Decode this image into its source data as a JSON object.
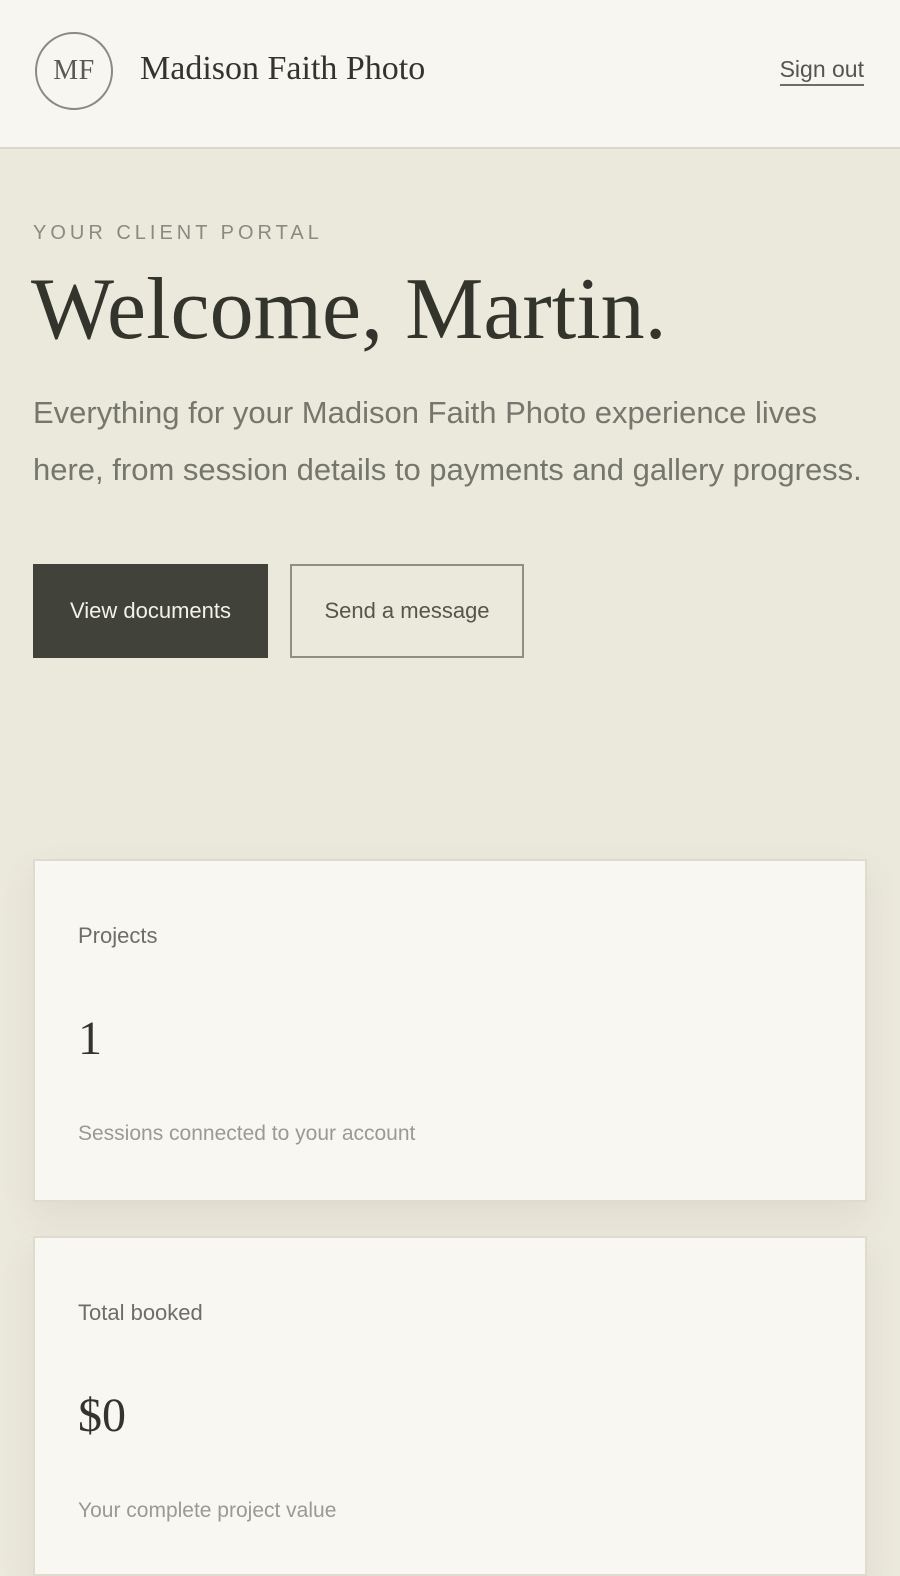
{
  "header": {
    "logo_initials": "MF",
    "brand_name": "Madison Faith Photo",
    "sign_out_label": "Sign out"
  },
  "hero": {
    "eyebrow": "YOUR CLIENT PORTAL",
    "title": "Welcome, Martin.",
    "intro": "Everything for your Madison Faith Photo experience lives here, from session details to payments and gallery progress.",
    "primary_button": "View documents",
    "secondary_button": "Send a message"
  },
  "stats": [
    {
      "label": "Projects",
      "value": "1",
      "description": "Sessions connected to your account"
    },
    {
      "label": "Total booked",
      "value": "$0",
      "description": "Your complete project value"
    }
  ]
}
